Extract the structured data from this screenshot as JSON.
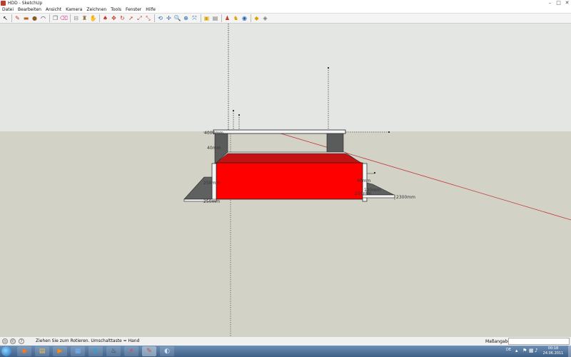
{
  "window": {
    "title": "HDD - SketchUp",
    "controls": {
      "minimize": "–",
      "maximize": "□",
      "close": "✕"
    }
  },
  "menu": [
    "Datei",
    "Bearbeiten",
    "Ansicht",
    "Kamera",
    "Zeichnen",
    "Tools",
    "Fenster",
    "Hilfe"
  ],
  "toolbar": {
    "tools": [
      {
        "name": "select",
        "glyph": "↖",
        "color": "#000000"
      },
      {
        "name": "line",
        "glyph": "✎",
        "color": "#c0392b"
      },
      {
        "name": "rectangle",
        "glyph": "▬",
        "color": "#b5651d"
      },
      {
        "name": "circle",
        "glyph": "●",
        "color": "#8b5a2b"
      },
      {
        "name": "arc",
        "glyph": "◠",
        "color": "#333333"
      },
      {
        "name": "make-component",
        "glyph": "❐",
        "color": "#666666"
      },
      {
        "name": "eraser",
        "glyph": "⌫",
        "color": "#d46aa5"
      },
      {
        "name": "tape-measure",
        "glyph": "⊟",
        "color": "#888888"
      },
      {
        "name": "paint-bucket",
        "glyph": "♜",
        "color": "#8a6d3b"
      },
      {
        "name": "pan-hand",
        "glyph": "✋",
        "color": "#555555"
      },
      {
        "name": "push-pull",
        "glyph": "♠",
        "color": "#c0392b"
      },
      {
        "name": "move",
        "glyph": "✥",
        "color": "#c0392b"
      },
      {
        "name": "rotate",
        "glyph": "↻",
        "color": "#c0392b"
      },
      {
        "name": "follow-me",
        "glyph": "➚",
        "color": "#c0392b"
      },
      {
        "name": "scale",
        "glyph": "⤢",
        "color": "#c0392b"
      },
      {
        "name": "offset",
        "glyph": "⤡",
        "color": "#c0392b"
      },
      {
        "name": "orbit",
        "glyph": "⟲",
        "color": "#1f5fb0"
      },
      {
        "name": "pan",
        "glyph": "✢",
        "color": "#1f5fb0"
      },
      {
        "name": "zoom",
        "glyph": "🔍",
        "color": "#1f5fb0"
      },
      {
        "name": "zoom-window",
        "glyph": "⊕",
        "color": "#1f5fb0"
      },
      {
        "name": "zoom-extents",
        "glyph": "⤧",
        "color": "#1f5fb0"
      },
      {
        "name": "get-photo-texture",
        "glyph": "▣",
        "color": "#d9a400"
      },
      {
        "name": "3d-warehouse",
        "glyph": "▤",
        "color": "#777777"
      },
      {
        "name": "share-model",
        "glyph": "♟",
        "color": "#c0392b"
      },
      {
        "name": "get-models",
        "glyph": "♞",
        "color": "#d9a400"
      },
      {
        "name": "preview-google-earth",
        "glyph": "◉",
        "color": "#1f5fb0"
      },
      {
        "name": "extension-warehouse",
        "glyph": "◆",
        "color": "#d9a400"
      },
      {
        "name": "dynamic-components",
        "glyph": "◈",
        "color": "#777777"
      }
    ]
  },
  "viewport": {
    "sky_color": "#e4e6e3",
    "ground_color": "#d2d2c7",
    "red_box_color": "#ff0000",
    "dark_face_color": "#5a5c5c",
    "dimensions": [
      "4000mm",
      "40mm",
      "250mm",
      "250mm",
      "40mm",
      "130mm",
      "250mm",
      "2300mm"
    ]
  },
  "status": {
    "text": "Ziehen Sie zum Rotieren.  Umschalttaste = Hand",
    "measure_label": "Maßangaben",
    "measure_value": ""
  },
  "taskbar": {
    "apps": [
      {
        "name": "firefox",
        "glyph": "◉",
        "color": "#ff7a1a"
      },
      {
        "name": "explorer",
        "glyph": "▤",
        "color": "#f2c14e"
      },
      {
        "name": "media-player",
        "glyph": "▶",
        "color": "#ff8a00"
      },
      {
        "name": "windows-explorer",
        "glyph": "▦",
        "color": "#6fb3ff"
      },
      {
        "name": "skype",
        "glyph": "S",
        "color": "#00aff0"
      },
      {
        "name": "steam",
        "glyph": "♨",
        "color": "#1b2838"
      },
      {
        "name": "flashget",
        "glyph": "⚡",
        "color": "#ff2a2a"
      },
      {
        "name": "sketchup",
        "glyph": "✎",
        "color": "#d34a2a"
      },
      {
        "name": "other-app",
        "glyph": "◐",
        "color": "#c9e4ff"
      }
    ],
    "language": "DE",
    "clock_time": "00:18",
    "clock_date": "24.06.2011"
  }
}
